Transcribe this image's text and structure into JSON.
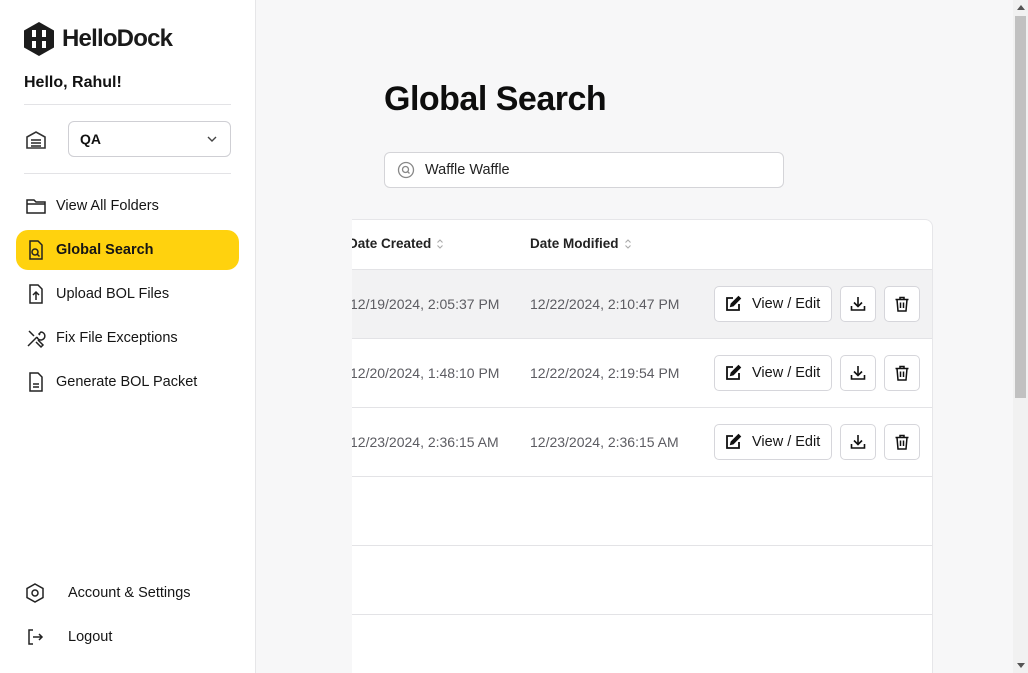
{
  "brand": {
    "name": "HelloDock",
    "accent_color": "#ffd20e"
  },
  "sidebar": {
    "greeting": "Hello, Rahul!",
    "workspace": {
      "value": "QA"
    },
    "nav": [
      {
        "label": "View All Folders",
        "icon": "folder-icon"
      },
      {
        "label": "Global Search",
        "icon": "document-search-icon",
        "active": true
      },
      {
        "label": "Upload BOL Files",
        "icon": "upload-file-icon"
      },
      {
        "label": "Fix File Exceptions",
        "icon": "tools-icon"
      },
      {
        "label": "Generate BOL Packet",
        "icon": "document-icon"
      }
    ],
    "bottom": [
      {
        "label": "Account & Settings",
        "icon": "gear-icon"
      },
      {
        "label": "Logout",
        "icon": "logout-icon"
      }
    ]
  },
  "main": {
    "title": "Global Search",
    "search": {
      "value": "Waffle Waffle"
    },
    "table": {
      "columns": [
        "Date Created",
        "Date Modified"
      ],
      "rows": [
        {
          "created": "12/19/2024, 2:05:37 PM",
          "modified": "12/22/2024, 2:10:47 PM",
          "edit_label": "View / Edit"
        },
        {
          "created": "12/20/2024, 1:48:10 PM",
          "modified": "12/22/2024, 2:19:54 PM",
          "edit_label": "View / Edit"
        },
        {
          "created": "12/23/2024, 2:36:15 AM",
          "modified": "12/23/2024, 2:36:15 AM",
          "edit_label": "View / Edit"
        }
      ]
    }
  }
}
